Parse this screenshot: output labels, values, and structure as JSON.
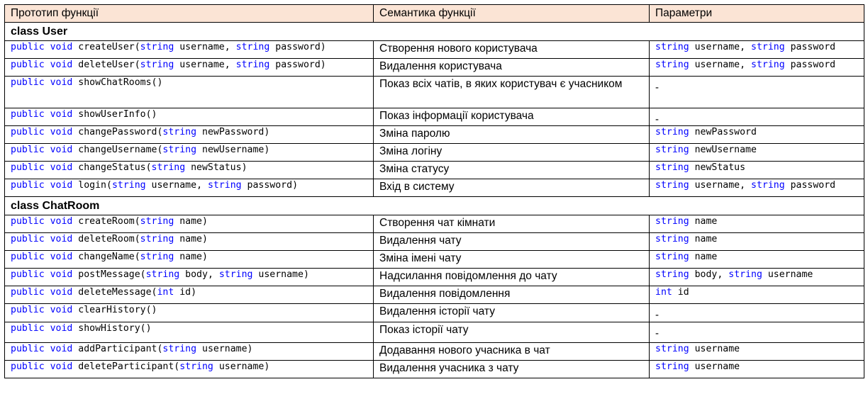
{
  "headers": {
    "prototype": "Прототип функції",
    "semantics": "Семантика функції",
    "params": "Параметри"
  },
  "keywords": {
    "public": "public",
    "void": "void",
    "string": "string",
    "int": "int"
  },
  "colors": {
    "header_bg": "#fbe4d5",
    "keyword": "#0000ff"
  },
  "sections": [
    {
      "title": "class User",
      "rows": [
        {
          "name": "createUser",
          "args": "string username, string password",
          "semantics": "Створення нового користувача",
          "params": "string username, string password"
        },
        {
          "name": "deleteUser",
          "args": "string username, string password",
          "semantics": "Видалення користувача",
          "params": "string username, string password"
        },
        {
          "name": "showChatRooms",
          "args": "",
          "semantics": "Показ всіх чатів, в яких користувач є учасником",
          "params": "-"
        },
        {
          "name": "showUserInfo",
          "args": "",
          "semantics": "Показ інформації користувача",
          "params": "-"
        },
        {
          "name": "changePassword",
          "args": "string newPassword",
          "semantics": "Зміна паролю",
          "params": "string newPassword"
        },
        {
          "name": "changeUsername",
          "args": "string newUsername",
          "semantics": "Зміна логіну",
          "params": "string newUsername"
        },
        {
          "name": "changeStatus",
          "args": "string newStatus",
          "semantics": "Зміна статусу",
          "params": "string newStatus"
        },
        {
          "name": "login",
          "args": "string username, string password",
          "semantics": "Вхід в систему",
          "params": "string username, string password"
        }
      ]
    },
    {
      "title": "class ChatRoom",
      "rows": [
        {
          "name": "createRoom",
          "args": "string name",
          "semantics": "Створення чат кімнати",
          "params": "string name"
        },
        {
          "name": "deleteRoom",
          "args": "string name",
          "semantics": "Видалення чату",
          "params": "string name"
        },
        {
          "name": "changeName",
          "args": "string name",
          "semantics": "Зміна імені чату",
          "params": "string name"
        },
        {
          "name": "postMessage",
          "args": "string body, string username",
          "semantics": "Надсилання повідомлення до чату",
          "params": "string body, string username"
        },
        {
          "name": "deleteMessage",
          "args": "int id",
          "semantics": "Видалення повідомлення",
          "params": "int id"
        },
        {
          "name": "clearHistory",
          "args": "",
          "semantics": "Видалення історії чату",
          "params": "-"
        },
        {
          "name": "showHistory",
          "args": "",
          "semantics": "Показ історії чату",
          "params": "-"
        },
        {
          "name": "addParticipant",
          "args": "string username",
          "semantics": "Додавання нового учасника в чат",
          "params": "string username"
        },
        {
          "name": "deleteParticipant",
          "args": "string username",
          "semantics": "Видалення учасника з чату",
          "params": "string username"
        }
      ]
    }
  ]
}
